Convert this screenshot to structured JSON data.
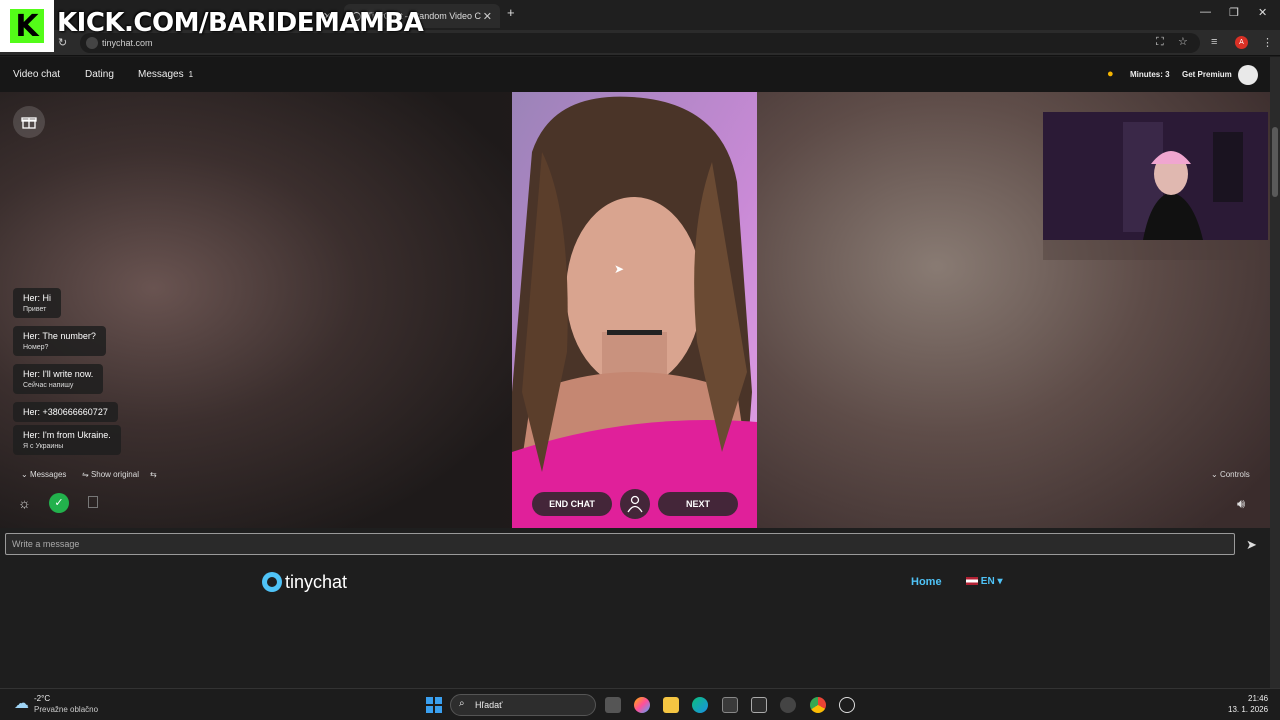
{
  "browser": {
    "tabs": [
      {
        "label": "",
        "active": false
      },
      {
        "label": "TinyChat – Random Video C",
        "active": true
      }
    ],
    "url": "tinychat.com",
    "new_tab": "+",
    "tab_close": "✕"
  },
  "overlay": {
    "kick_letter": "K",
    "kick_text": "KICK.COM/BARIDEMAMBA"
  },
  "site_nav": {
    "items": [
      {
        "label": "Video chat"
      },
      {
        "label": "Dating"
      },
      {
        "label": "Messages",
        "badge": "1"
      }
    ],
    "minutes": "Minutes: 3",
    "premium": "Get Premium"
  },
  "chat": {
    "messages": [
      {
        "text": "Her: Hi",
        "translation": "Привет"
      },
      {
        "text": "Her: The number?",
        "translation": "Номер?"
      },
      {
        "text": "Her: I'll write now.",
        "translation": "Сейчас напишу"
      },
      {
        "text": "Her: +380666660727",
        "translation": ""
      },
      {
        "text": "Her: I'm from Ukraine.",
        "translation": "Я с Украины"
      }
    ],
    "messages_toggle": "Messages",
    "show_original": "Show original",
    "controls": "Controls",
    "input_placeholder": "Write a message"
  },
  "buttons": {
    "end_chat": "END CHAT",
    "next": "NEXT"
  },
  "footer": {
    "brand": "tinychat",
    "home": "Home",
    "language": "EN"
  },
  "taskbar": {
    "weather_temp": "-2°C",
    "weather_desc": "Prevažne oblačno",
    "search": "Hľadať",
    "time": "21:46",
    "date": "13. 1. 2026"
  },
  "colors": {
    "accent": "#4fc3f7",
    "kick_green": "#53fc18",
    "approve_green": "#22b14c"
  }
}
